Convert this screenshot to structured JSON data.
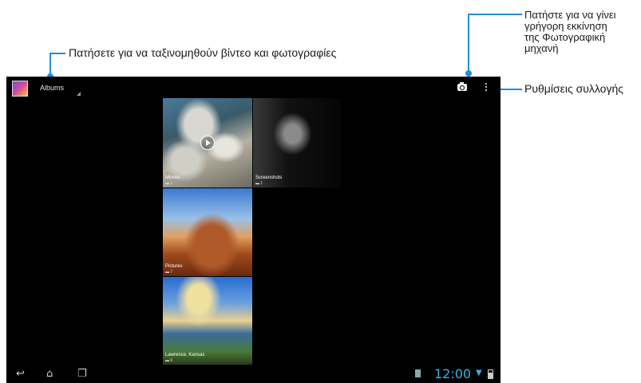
{
  "callouts": {
    "sort": "Πατήσετε για να ταξινομηθούν βίντεο και φωτογραφίες",
    "camera": [
      "Πατήστε για να γίνει",
      "γρήγορη εκκίνηση",
      "της Φωτογραφική",
      "μηχανή"
    ],
    "settings": "Ρυθμίσεις συλλογής"
  },
  "actionbar": {
    "title": "Albums",
    "icons": [
      "gallery-app-icon",
      "camera-icon",
      "overflow-menu-icon"
    ]
  },
  "albums": [
    {
      "name": "Movies",
      "count": "1",
      "video": true
    },
    {
      "name": "Screenshots",
      "count": "1"
    },
    {
      "name": "Pictures",
      "count": "7"
    },
    {
      "name": "Lawrence, Kansas",
      "count": "6"
    }
  ],
  "navbar": {
    "icons": [
      "back-icon",
      "home-icon",
      "recent-apps-icon"
    ],
    "time": "12:00",
    "status_icons": [
      "sd-card-icon",
      "wifi-icon",
      "battery-icon"
    ]
  },
  "colors": {
    "accent": "#1f8fd8",
    "clock": "#33b5e5",
    "screen": "#000000"
  }
}
